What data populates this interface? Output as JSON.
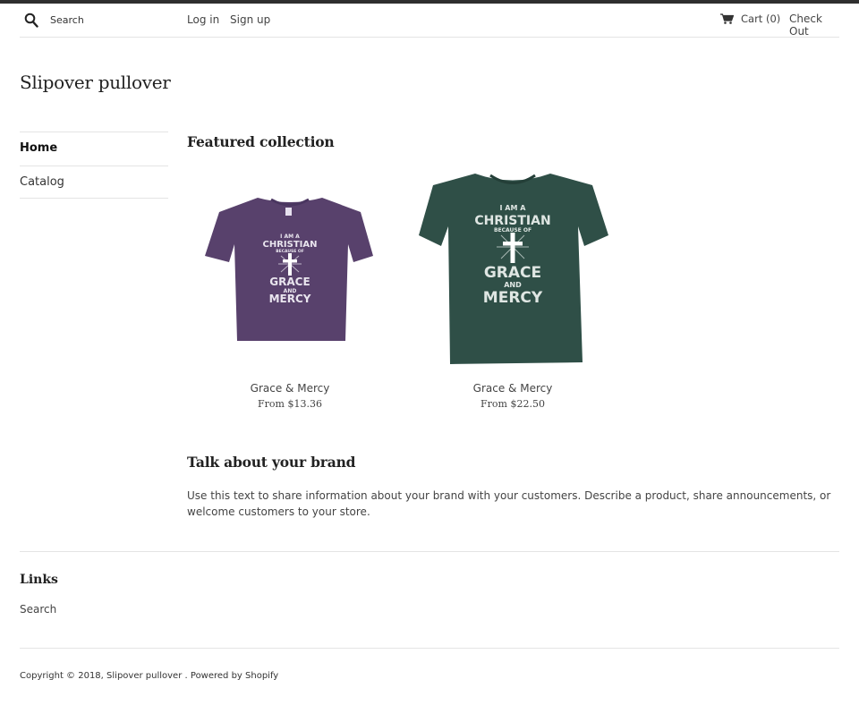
{
  "header": {
    "search_placeholder": "Search",
    "login_label": "Log in",
    "signup_label": "Sign up",
    "cart_label": "Cart (0)",
    "checkout_label": "Check Out"
  },
  "site": {
    "title": "Slipover pullover"
  },
  "sidebar": {
    "items": [
      {
        "label": "Home",
        "active": true
      },
      {
        "label": "Catalog",
        "active": false
      }
    ]
  },
  "featured": {
    "title": "Featured collection",
    "products": [
      {
        "name": "Grace & Mercy",
        "price": "From $13.36",
        "shirt_color": "#58416c",
        "print_lines": [
          "I AM A",
          "CHRISTIAN",
          "BECAUSE OF",
          "GRACE",
          "AND",
          "MERCY"
        ]
      },
      {
        "name": "Grace & Mercy",
        "price": "From $22.50",
        "shirt_color": "#2f4f47",
        "print_lines": [
          "I AM A",
          "CHRISTIAN",
          "BECAUSE OF",
          "GRACE",
          "AND",
          "MERCY"
        ]
      }
    ]
  },
  "brand": {
    "title": "Talk about your brand",
    "text": "Use this text to share information about your brand with your customers. Describe a product, share announcements, or welcome customers to your store."
  },
  "footer": {
    "links_title": "Links",
    "links": [
      "Search"
    ],
    "copyright_prefix": "Copyright © 2018,",
    "copyright_store": "Slipover pullover",
    "copyright_sep": ".",
    "powered_by": "Powered by Shopify"
  },
  "icons": {
    "search": "search-icon",
    "cart": "cart-icon"
  }
}
